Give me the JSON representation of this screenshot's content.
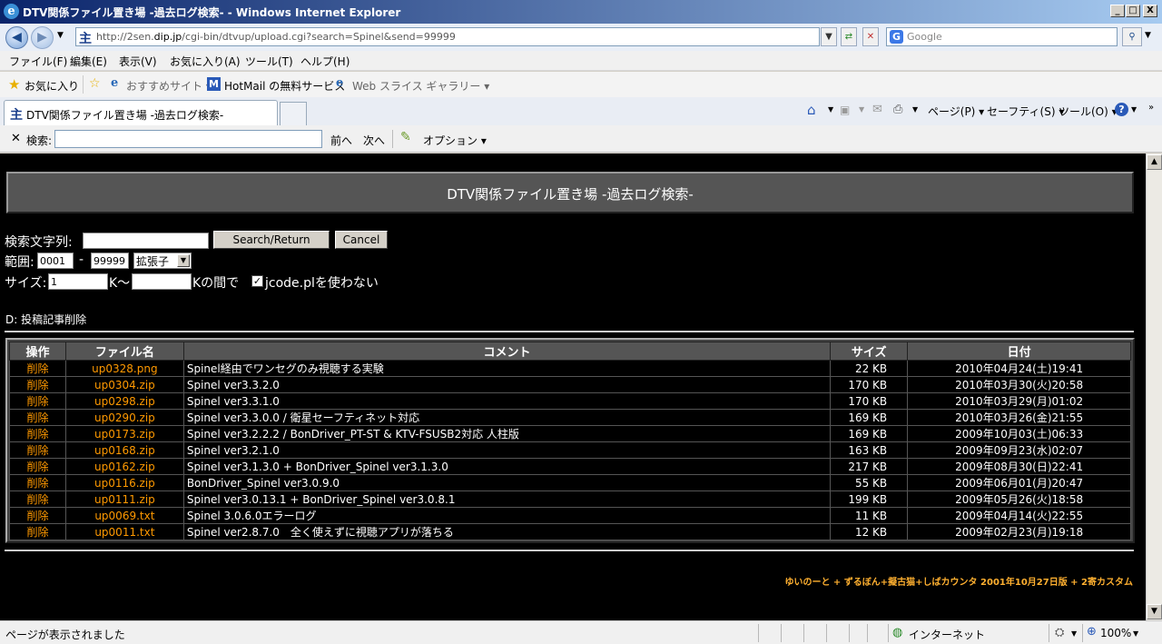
{
  "window": {
    "title": "DTV関係ファイル置き場 -過去ログ検索- - Windows Internet Explorer",
    "minimize": "_",
    "maximize": "□",
    "close": "X"
  },
  "address": {
    "url_prefix": "http://2sen.",
    "url_host": "dip.jp",
    "url_rest": "/cgi-bin/dtvup/upload.cgi?search=Spinel&send=99999",
    "search_placeholder": "Google"
  },
  "menu": [
    "ファイル(F)",
    "編集(E)",
    "表示(V)",
    "お気に入り(A)",
    "ツール(T)",
    "ヘルプ(H)"
  ],
  "favorites": {
    "label": "お気に入り",
    "items": [
      "おすすめサイト ▾",
      "HotMail の無料サービス",
      "Web スライス ギャラリー ▾"
    ]
  },
  "tab": {
    "title": "DTV関係ファイル置き場 -過去ログ検索-"
  },
  "commands": [
    "ページ(P) ▾",
    "セーフティ(S) ▾",
    "ツール(O) ▾"
  ],
  "findbar": {
    "label": "検索:",
    "prev": "前へ",
    "next": "次へ",
    "options": "オプション ▾"
  },
  "page": {
    "heading": "DTV関係ファイル置き場 -過去ログ検索-",
    "search_label": "検索文字列:",
    "search_value": "",
    "search_button": "Search/Return",
    "cancel_button": "Cancel",
    "range_label": "範囲:",
    "range_from": "0001",
    "range_sep": "-",
    "range_to": "99999",
    "sort_select": "拡張子",
    "size_label": "サイズ:",
    "size_min": "1",
    "size_unit1": "K〜",
    "size_max": "",
    "size_unit2": "Kの間で",
    "jcode_checked": true,
    "jcode_label": "jcode.plを使わない",
    "note": "D: 投稿記事削除",
    "table_headers": [
      "操作",
      "ファイル名",
      "コメント",
      "サイズ",
      "日付"
    ],
    "rows": [
      {
        "op": "削除",
        "file": "up0328.png",
        "comment": "Spinel経由でワンセグのみ視聴する実験",
        "size": "22 KB",
        "date": "2010年04月24(土)19:41"
      },
      {
        "op": "削除",
        "file": "up0304.zip",
        "comment": "Spinel ver3.3.2.0",
        "size": "170 KB",
        "date": "2010年03月30(火)20:58"
      },
      {
        "op": "削除",
        "file": "up0298.zip",
        "comment": "Spinel ver3.3.1.0",
        "size": "170 KB",
        "date": "2010年03月29(月)01:02"
      },
      {
        "op": "削除",
        "file": "up0290.zip",
        "comment": "Spinel ver3.3.0.0 / 衛星セーフティネット対応",
        "size": "169 KB",
        "date": "2010年03月26(金)21:55"
      },
      {
        "op": "削除",
        "file": "up0173.zip",
        "comment": "Spinel ver3.2.2.2 / BonDriver_PT-ST & KTV-FSUSB2対応 人柱版",
        "size": "169 KB",
        "date": "2009年10月03(土)06:33"
      },
      {
        "op": "削除",
        "file": "up0168.zip",
        "comment": "Spinel ver3.2.1.0",
        "size": "163 KB",
        "date": "2009年09月23(水)02:07"
      },
      {
        "op": "削除",
        "file": "up0162.zip",
        "comment": "Spinel ver3.1.3.0 + BonDriver_Spinel ver3.1.3.0",
        "size": "217 KB",
        "date": "2009年08月30(日)22:41"
      },
      {
        "op": "削除",
        "file": "up0116.zip",
        "comment": "BonDriver_Spinel ver3.0.9.0",
        "size": "55 KB",
        "date": "2009年06月01(月)20:47"
      },
      {
        "op": "削除",
        "file": "up0111.zip",
        "comment": "Spinel ver3.0.13.1 + BonDriver_Spinel ver3.0.8.1",
        "size": "199 KB",
        "date": "2009年05月26(火)18:58"
      },
      {
        "op": "削除",
        "file": "up0069.txt",
        "comment": "Spinel 3.0.6.0エラーログ",
        "size": "11 KB",
        "date": "2009年04月14(火)22:55"
      },
      {
        "op": "削除",
        "file": "up0011.txt",
        "comment": "Spinel ver2.8.7.0　全く使えずに視聴アプリが落ちる",
        "size": "12 KB",
        "date": "2009年02月23(月)19:18"
      }
    ],
    "footer": "ゆいのーと + ずるぼん+擬古猫+しばカウンタ 2001年10月27日版 + 2寄カスタム"
  },
  "status": {
    "text": "ページが表示されました",
    "zone": "インターネット",
    "zoom": "100%"
  }
}
